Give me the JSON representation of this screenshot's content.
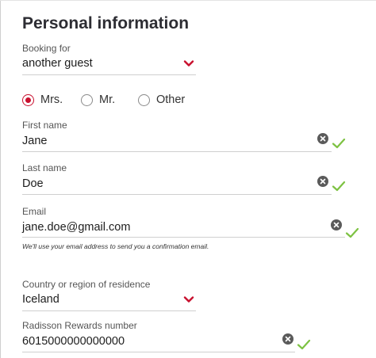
{
  "section": {
    "title": "Personal information"
  },
  "booking_for": {
    "label": "Booking for",
    "value": "another guest"
  },
  "salutation": {
    "options": [
      "Mrs.",
      "Mr.",
      "Other"
    ],
    "selected": "Mrs."
  },
  "first_name": {
    "label": "First name",
    "value": "Jane"
  },
  "last_name": {
    "label": "Last name",
    "value": "Doe"
  },
  "email": {
    "label": "Email",
    "value": "jane.doe@gmail.com",
    "help": "We'll use your email address to send you a confirmation email."
  },
  "country": {
    "label": "Country or region of residence",
    "value": "Iceland"
  },
  "rewards": {
    "label": "Radisson Rewards number",
    "value": "6015000000000000"
  },
  "icons": {
    "dropdown": "chevron-down-icon",
    "clear": "clear-icon",
    "valid": "checkmark-icon"
  },
  "colors": {
    "accent": "#c8102e",
    "valid": "#7dc242",
    "clear": "#5a5a5a"
  }
}
